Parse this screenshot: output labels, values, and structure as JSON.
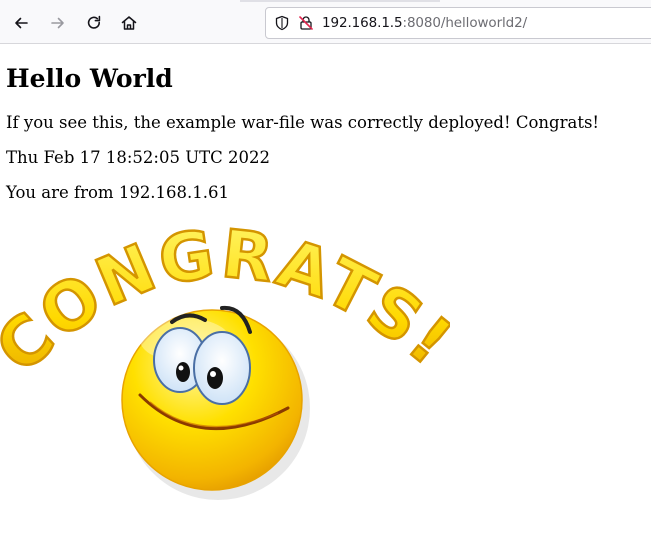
{
  "browser": {
    "url_host": "192.168.1.5",
    "url_rest": ":8080/helloworld2/"
  },
  "page": {
    "heading": "Hello World",
    "paragraph_1": "If you see this, the example war-file was correctly deployed! Congrats!",
    "paragraph_2": "Thu Feb 17 18:52:05 UTC 2022",
    "paragraph_3": "You are from 192.168.1.61"
  },
  "image": {
    "congrats_text": "CONGRATS!"
  },
  "colors": {
    "text": "#000000",
    "url_host": "#15141a",
    "url_rest": "#6d6d73",
    "toolbar_bg": "#f9f9fb",
    "congrats_yellow": "#ffe000",
    "congrats_orange": "#f2a900"
  }
}
